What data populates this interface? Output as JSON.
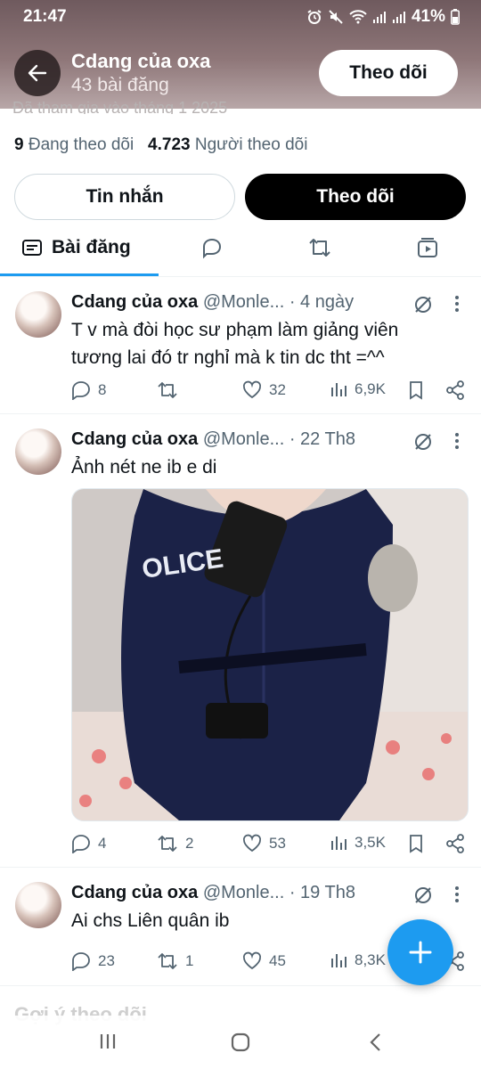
{
  "status_bar": {
    "time": "21:47",
    "battery": "41%",
    "icons": [
      "alarm-icon",
      "mute-icon",
      "wifi-icon",
      "signal-icon",
      "signal-icon",
      "battery-icon"
    ]
  },
  "header": {
    "name": "Cdang của oxa",
    "post_count": "43 bài đăng",
    "follow_label": "Theo dõi",
    "partial_text": "Đã tham gia vào tháng 1 2025"
  },
  "stats": {
    "following_count": "9",
    "following_label": "Đang theo dõi",
    "followers_count": "4.723",
    "followers_label": "Người theo dõi"
  },
  "buttons": {
    "message_label": "Tin nhắn",
    "follow_label": "Theo dõi"
  },
  "tabs": {
    "posts_label": "Bài đăng",
    "icons": [
      "posts-icon",
      "replies-icon",
      "reposts-icon",
      "media-icon"
    ]
  },
  "tweets": [
    {
      "name": "Cdang của oxa",
      "handle": "@Monle...",
      "date": "· 4 ngày",
      "text": "T v mà đòi học sư phạm làm giảng viên tương lai đó tr nghỉ mà k tin dc tht =^^",
      "replies": "8",
      "reposts": "",
      "likes": "32",
      "views": "6,9K"
    },
    {
      "name": "Cdang của oxa",
      "handle": "@Monle...",
      "date": "· 22 Th8",
      "text": "Ảnh nét ne ib e di",
      "replies": "4",
      "reposts": "2",
      "likes": "53",
      "views": "3,5K"
    },
    {
      "name": "Cdang của oxa",
      "handle": "@Monle...",
      "date": "· 19 Th8",
      "text": "Ai chs Liên quân ib",
      "replies": "23",
      "reposts": "1",
      "likes": "45",
      "views": "8,3K"
    }
  ],
  "suggestions_title": "Gợi ý theo dõi",
  "colors": {
    "accent": "#1d9bf0",
    "text": "#0f1419",
    "muted": "#536471"
  }
}
